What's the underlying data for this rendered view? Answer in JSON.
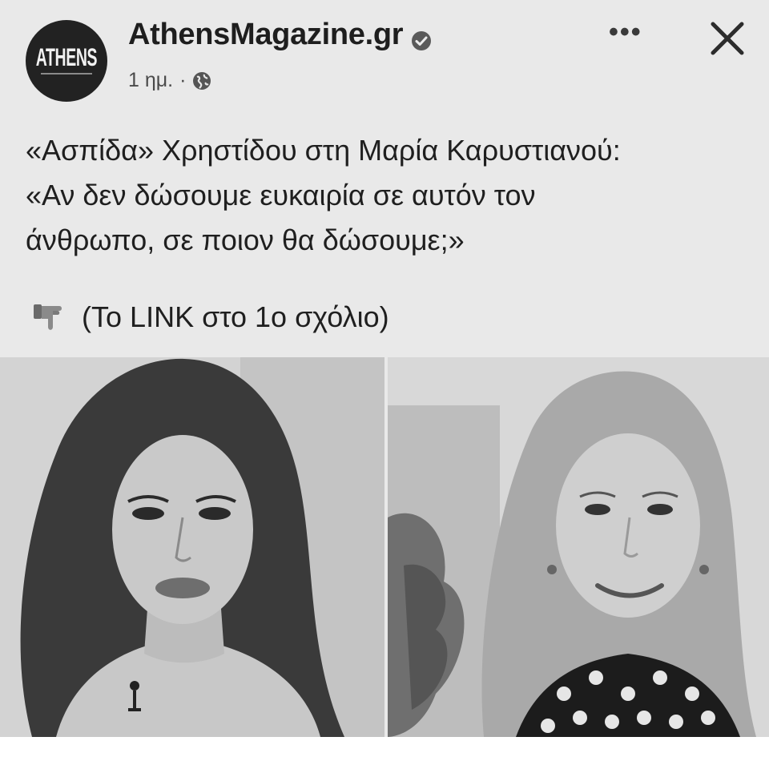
{
  "header": {
    "avatar_text": "ATHENS",
    "page_name": "AthensMagazine.gr",
    "time": "1 ημ.",
    "separator": "·",
    "verified_icon": "verified-badge-icon",
    "audience_icon": "globe-icon",
    "more_label": "•••",
    "close_icon": "close-icon"
  },
  "post": {
    "lines": [
      "«Ασπίδα» Χρηστίδου στη Μαρία Καρυστιανού:",
      "«Αν δεν δώσουμε ευκαιρία σε αυτόν τον",
      "άνθρωπο, σε ποιον θα δώσουμε;»"
    ],
    "link_text": "(Το LINK στο 1ο σχόλιο)",
    "link_icon": "pointing-hand-icon"
  },
  "colors": {
    "background": "#e9e9e9",
    "text": "#1f1f1f",
    "avatar_bg": "#222222"
  }
}
